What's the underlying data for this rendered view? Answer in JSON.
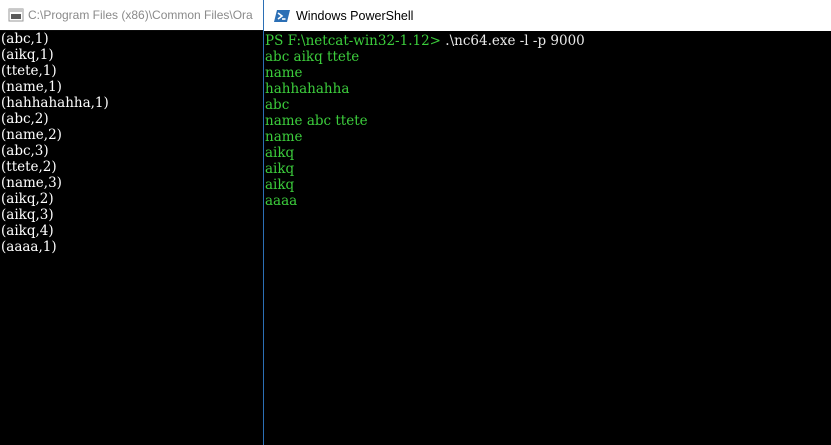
{
  "left_window": {
    "title": "C:\\Program Files (x86)\\Common Files\\Ora",
    "icon": "console-app-icon",
    "lines": [
      "(abc,1)",
      "(aikq,1)",
      "(ttete,1)",
      "(name,1)",
      "(hahhahahha,1)",
      "(abc,2)",
      "(name,2)",
      "(abc,3)",
      "(ttete,2)",
      "(name,3)",
      "(aikq,2)",
      "(aikq,3)",
      "(aikq,4)",
      "(aaaa,1)"
    ]
  },
  "powershell_window": {
    "title": "Windows PowerShell",
    "icon": "powershell-icon",
    "prompt": "PS F:\\netcat-win32-1.12>",
    "command": " .\\nc64.exe -l -p 9000",
    "output_lines": [
      "abc aikq ttete",
      "name",
      "hahhahahha",
      "abc",
      "name abc ttete",
      "name",
      "aikq",
      "aikq",
      "aikq",
      "aaaa"
    ]
  },
  "colors": {
    "prompt_green": "#3ccd3c",
    "console_background": "#000000",
    "titlebar_background": "#ffffff",
    "window_border_blue": "#2b6fb5"
  }
}
